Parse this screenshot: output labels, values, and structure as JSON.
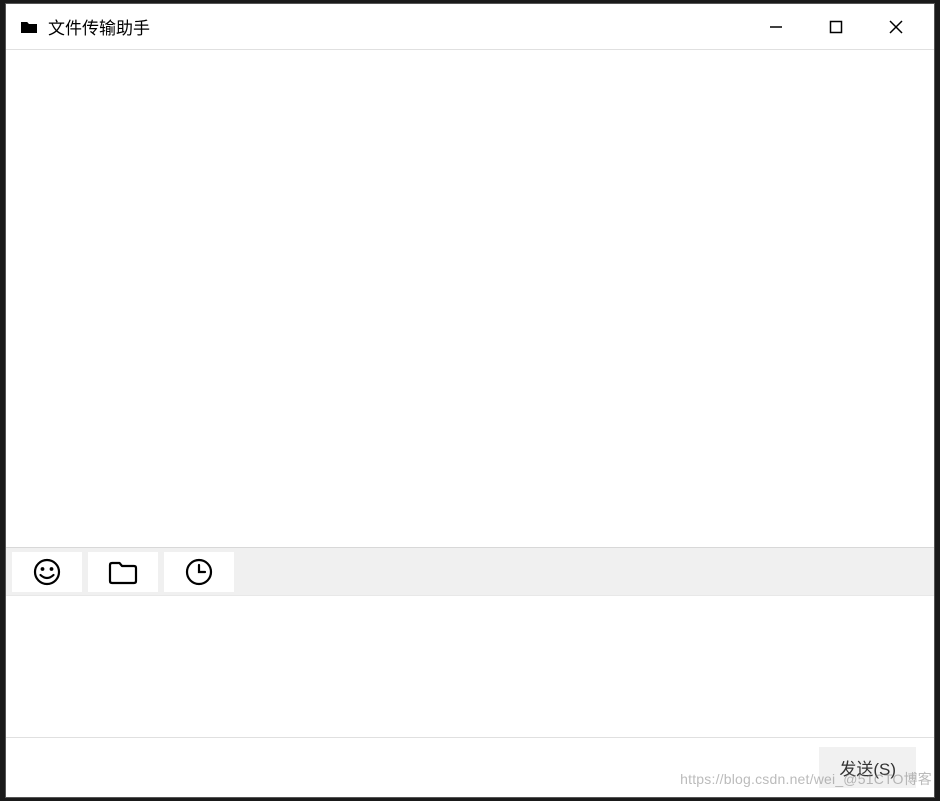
{
  "titlebar": {
    "title": "文件传输助手"
  },
  "toolbar": {
    "emoji_icon": "emoji",
    "folder_icon": "folder",
    "history_icon": "history"
  },
  "input": {
    "value": "",
    "placeholder": ""
  },
  "send_bar": {
    "send_label": "发送(S)"
  },
  "watermark": "https://blog.csdn.net/wei_@51CTO博客"
}
